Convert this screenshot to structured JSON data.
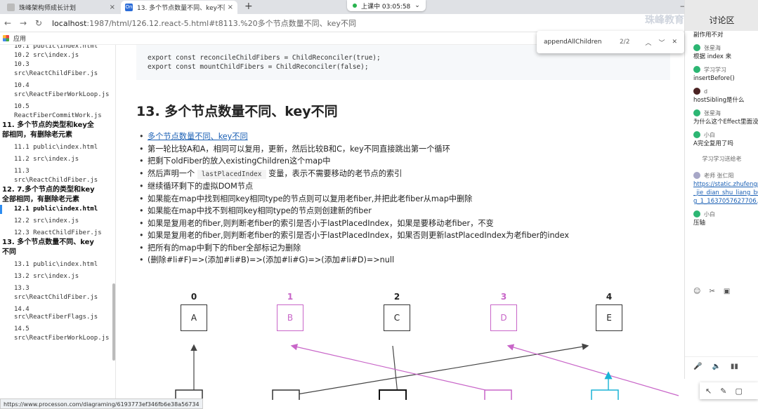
{
  "tabs": [
    {
      "title": "珠峰架构师成长计划",
      "active": false
    },
    {
      "title": "13. 多个节点数量不同、key不同 - P",
      "active": true
    }
  ],
  "live_status": "上课中 03:05:58",
  "address": {
    "host": "localhost",
    "path": ":1987/html/126.12.react-5.html#t8113.%20多个节点数量不同、key不同"
  },
  "bookmarks_label": "应用",
  "find": {
    "query": "appendAllChildren",
    "count": "2/2"
  },
  "toc": {
    "items": [
      {
        "kind": "it",
        "text": "10.1 public\\index.html"
      },
      {
        "kind": "it",
        "text": "10.2 src\\index.js"
      },
      {
        "kind": "it",
        "text": "10.3"
      },
      {
        "kind": "it",
        "text": "src\\ReactChildFiber.js"
      },
      {
        "kind": "it",
        "text": "10.4",
        "spaced": true
      },
      {
        "kind": "it",
        "text": "src\\ReactFiberWorkLoop.js"
      },
      {
        "kind": "it",
        "text": "10.5",
        "spaced": true
      },
      {
        "kind": "it",
        "text": "ReactFiberCommitWork.js"
      },
      {
        "kind": "sec",
        "text": "11. 多个节点的类型和key全"
      },
      {
        "kind": "sec",
        "text": "部相同，有删除老元素"
      },
      {
        "kind": "it",
        "text": "11.1 public\\index.html",
        "spaced": true
      },
      {
        "kind": "it",
        "text": "11.2 src\\index.js",
        "spaced": true
      },
      {
        "kind": "it",
        "text": "11.3",
        "spaced": true
      },
      {
        "kind": "it",
        "text": "src\\ReactChildFiber.js"
      },
      {
        "kind": "sec",
        "text": "12. 7.多个节点的类型和key"
      },
      {
        "kind": "sec",
        "text": "全部相同，有删除老元素"
      },
      {
        "kind": "it",
        "text": "12.1 public\\index.html",
        "active": true
      },
      {
        "kind": "it",
        "text": "12.2 src\\index.js",
        "spaced": true
      },
      {
        "kind": "it",
        "text": "12.3 ReactChildFiber.js",
        "spaced": true
      },
      {
        "kind": "sec",
        "text": "13. 多个节点数量不同、key"
      },
      {
        "kind": "sec",
        "text": "不同"
      },
      {
        "kind": "it",
        "text": "13.1 public\\index.html",
        "spaced": true
      },
      {
        "kind": "it",
        "text": "13.2 src\\index.js",
        "spaced": true
      },
      {
        "kind": "it",
        "text": "13.3",
        "spaced": true
      },
      {
        "kind": "it",
        "text": "src\\ReactChildFiber.js"
      },
      {
        "kind": "it",
        "text": "14.4 src\\ReactFiberFlags.js",
        "spaced": true
      },
      {
        "kind": "it",
        "text": "14.5",
        "spaced": true
      },
      {
        "kind": "it",
        "text": "src\\ReactFiberWorkLoop.js"
      }
    ]
  },
  "code": {
    "line1": "export const reconcileChildFibers = ChildReconciler(true);",
    "line2": "export const mountChildFibers = ChildReconciler(false);"
  },
  "heading": "13. 多个节点数量不同、key不同",
  "bullets": {
    "link": "多个节点数量不同、key不同",
    "b1": "第一轮比较A和A，相同可以复用，更新，然后比较B和C，key不同直接跳出第一个循环",
    "b2": "把剩下oldFiber的放入existingChildren这个map中",
    "b3_pre": "然后声明一个",
    "b3_code": "lastPlacedIndex",
    "b3_post": "变量，表示不需要移动的老节点的索引",
    "b4": "继续循环剩下的虚拟DOM节点",
    "b5": "如果能在map中找到相同key相同type的节点则可以复用老fiber,并把此老fiber从map中删除",
    "b6": "如果能在map中找不到相同key相同type的节点则创建新的fiber",
    "b7": "如果是复用老的fiber,则判断老fiber的索引是否小于lastPlacedIndex，如果是要移动老fiber，不变",
    "b8": "如果是复用老的fiber,则判断老fiber的索引是否小于lastPlacedIndex，如果否则更新lastPlacedIndex为老fiber的index",
    "b9": "把所有的map中剩下的fiber全部标记为删除",
    "b10": "(删除#li#F)=>(添加#li#B)=>(添加#li#G)=>(添加#li#D)=>null"
  },
  "diagram": {
    "old_nodes": [
      {
        "index": "0",
        "label": "A",
        "color": "#333333"
      },
      {
        "index": "1",
        "label": "B",
        "color": "#c865c8"
      },
      {
        "index": "2",
        "label": "C",
        "color": "#333333"
      },
      {
        "index": "3",
        "label": "D",
        "color": "#c865c8"
      },
      {
        "index": "4",
        "label": "E",
        "color": "#333333"
      }
    ]
  },
  "chat": {
    "title": "讨论区",
    "messages": [
      {
        "who": "",
        "text": "副作用不对"
      },
      {
        "who": "张星海",
        "text": "根据 index 来"
      },
      {
        "who": "学习学习",
        "text": "insertBefore()"
      },
      {
        "who": "d",
        "text": "hostSibling是什么"
      },
      {
        "who": "张星海",
        "text": "为什么这个Effect里面没"
      },
      {
        "who": "小白",
        "text": "A完全复用了吗"
      }
    ],
    "system_note": "学习学习送给老",
    "teacher": {
      "who": "老师 张仁阳",
      "link1": "https://static.zhufengp",
      "link2": "_jie_dian_shu_liang_bu",
      "link3": "g_1_1637057627706.jp"
    },
    "last": {
      "who": "小白",
      "text": "压轴"
    }
  },
  "watermark": "珠峰教育",
  "status_url": "https://www.processon.com/diagraming/6193773ef346fb6e38a56734",
  "colors": {
    "accent": "#2d8cf0",
    "pink": "#c865c8",
    "cyan": "#1ab3d6",
    "green": "#2cb673"
  }
}
